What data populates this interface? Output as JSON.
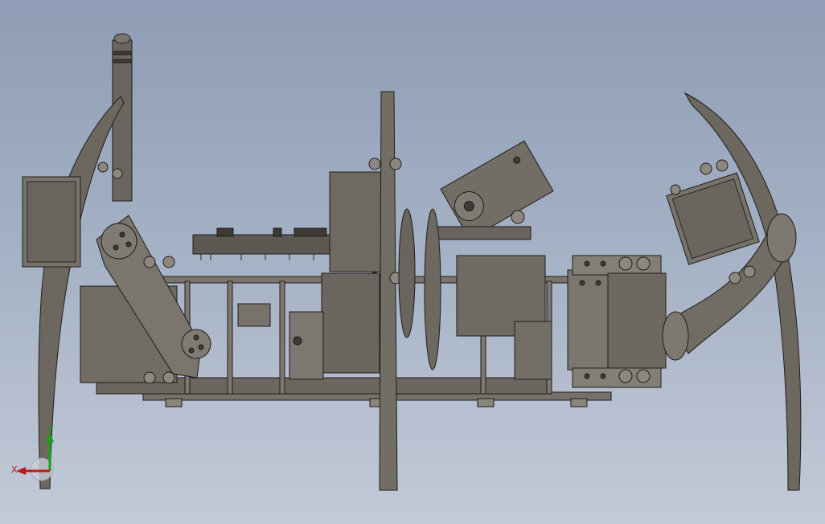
{
  "scene": {
    "description_hidden": "",
    "background_top": "#8e9db5",
    "background_bottom": "#c2cad8",
    "part_fill": "#6f6a62",
    "part_fill_light": "#807b72",
    "part_fill_dark": "#4e4a44",
    "edge_color": "#1f1d1a"
  },
  "triad": {
    "x_label": "X",
    "y_label": "Y",
    "x_color": "#c01818",
    "y_color": "#18a018",
    "x_icon": "x-axis-arrow-icon",
    "y_icon": "y-axis-arrow-icon"
  }
}
